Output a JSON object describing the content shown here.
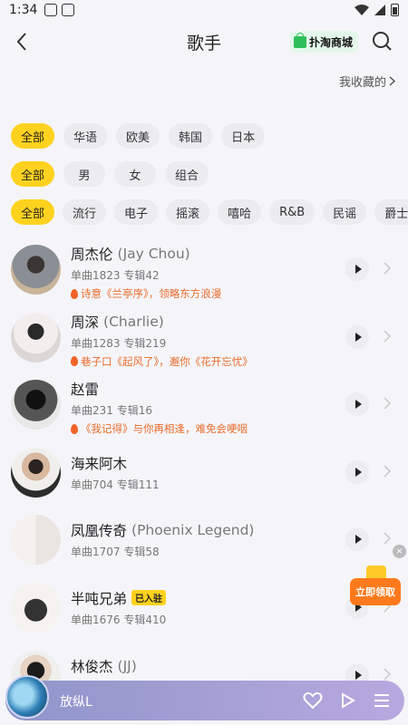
{
  "status_bar": {
    "time": "1:34"
  },
  "header": {
    "title": "歌手",
    "shop_label": "扑淘商城"
  },
  "favorites": {
    "label": "我收藏的"
  },
  "filters": {
    "region": [
      "全部",
      "华语",
      "欧美",
      "韩国",
      "日本"
    ],
    "gender": [
      "全部",
      "男",
      "女",
      "组合"
    ],
    "genre": [
      "全部",
      "流行",
      "电子",
      "摇滚",
      "嘻哈",
      "R&B",
      "民谣",
      "爵士"
    ]
  },
  "artists": [
    {
      "name": "周杰伦",
      "en": "(Jay Chou)",
      "stats": "单曲1823 专辑42",
      "desc": "诗意《兰亭序》，领略东方浪漫",
      "avatar_color": "#8a7a6a"
    },
    {
      "name": "周深",
      "en": "(Charlie)",
      "stats": "单曲1283 专辑219",
      "desc": "巷子口《起风了》，邂你《花开忘忧》",
      "avatar_color": "#d8d0cc"
    },
    {
      "name": "赵雷",
      "en": "",
      "stats": "单曲231 专辑16",
      "desc": "《我记得》与你再相逢，难免会哽咽",
      "avatar_color": "#3a3a3a"
    },
    {
      "name": "海来阿木",
      "en": "",
      "stats": "单曲704 专辑111",
      "desc": "",
      "avatar_color": "#6a4f3e"
    },
    {
      "name": "凤凰传奇",
      "en": "(Phoenix Legend)",
      "stats": "单曲1707 专辑58",
      "desc": "",
      "avatar_color": "#c9b9a8"
    },
    {
      "name": "半吨兄弟",
      "en": "",
      "badge": "已入驻",
      "stats": "单曲1676 专辑410",
      "desc": "",
      "avatar_color": "#e8e2da"
    },
    {
      "name": "林俊杰",
      "en": "(JJ)",
      "stats": "",
      "desc": "",
      "avatar_color": "#2b2b2b"
    }
  ],
  "promo": {
    "label": "立即领取",
    "close": "×"
  },
  "player": {
    "song": "放纵L"
  },
  "colors": {
    "accent": "#ffd21f",
    "highlight_text": "#e96c2c"
  }
}
